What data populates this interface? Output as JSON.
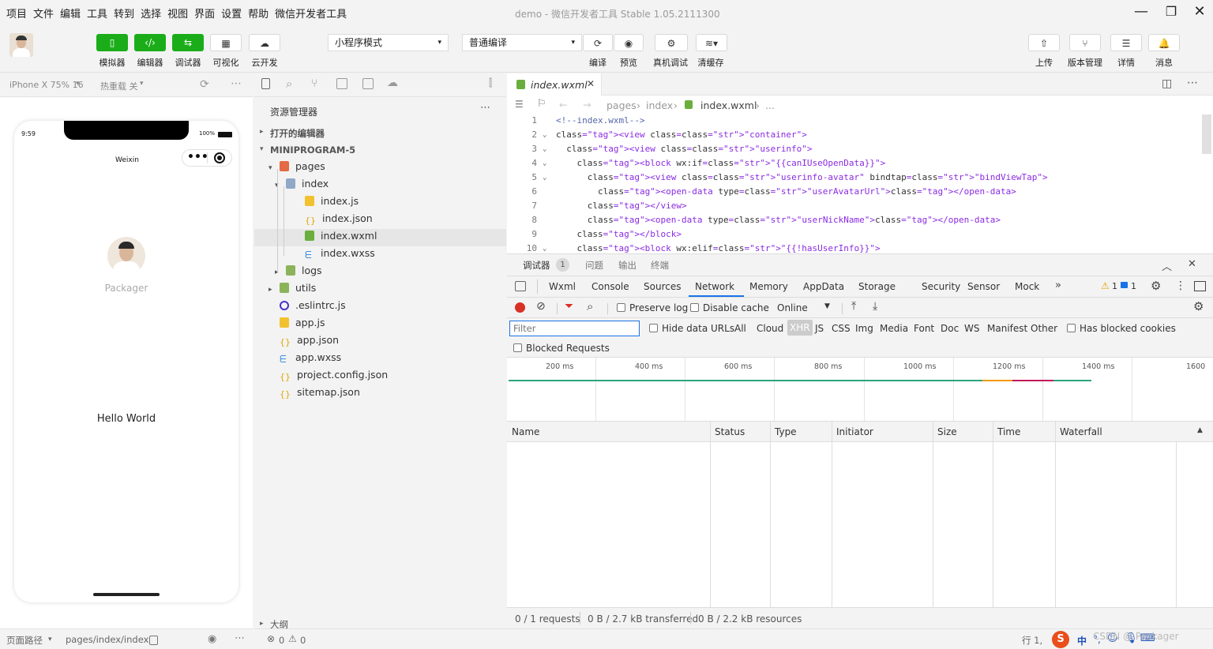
{
  "menu": [
    "项目",
    "文件",
    "编辑",
    "工具",
    "转到",
    "选择",
    "视图",
    "界面",
    "设置",
    "帮助",
    "微信开发者工具"
  ],
  "window_title": "demo - 微信开发者工具 Stable 1.05.2111300",
  "toolbar": {
    "left_buttons": [
      {
        "icon": "phone-icon",
        "label": "模拟器"
      },
      {
        "icon": "code-icon",
        "label": "编辑器"
      },
      {
        "icon": "debug-icon",
        "label": "调试器"
      },
      {
        "icon": "visual-icon",
        "label": "可视化"
      },
      {
        "icon": "cloud-icon",
        "label": "云开发"
      }
    ],
    "mode_select": "小程序模式",
    "compile_select": "普通编译",
    "mid_buttons": [
      {
        "icon": "refresh-icon",
        "label": "编译"
      },
      {
        "icon": "eye-icon",
        "label": "预览"
      },
      {
        "icon": "bug-icon",
        "label": "真机调试"
      },
      {
        "icon": "layers-icon",
        "label": "清缓存"
      }
    ],
    "right_buttons": [
      {
        "icon": "upload-icon",
        "label": "上传"
      },
      {
        "icon": "branch-icon",
        "label": "版本管理"
      },
      {
        "icon": "menu-icon",
        "label": "详情"
      },
      {
        "icon": "bell-icon",
        "label": "消息"
      }
    ]
  },
  "simulator": {
    "device": "iPhone X 75% 16",
    "hot_reload": "热重载 关",
    "time": "9:59",
    "battery": "100%",
    "nav_title": "Weixin",
    "nickname": "Packager",
    "hello": "Hello World"
  },
  "sim_status": {
    "path_label": "页面路径",
    "path": "pages/index/index"
  },
  "explorer": {
    "title": "资源管理器",
    "open_editors": "打开的编辑器",
    "project": "MINIPROGRAM-5",
    "items": [
      {
        "label": "pages",
        "depth": 1,
        "type": "folder-red",
        "arrow": "▾"
      },
      {
        "label": "index",
        "depth": 2,
        "type": "folder",
        "arrow": "▾"
      },
      {
        "label": "index.js",
        "depth": 3,
        "type": "js"
      },
      {
        "label": "index.json",
        "depth": 3,
        "type": "json"
      },
      {
        "label": "index.wxml",
        "depth": 3,
        "type": "wxml"
      },
      {
        "label": "index.wxss",
        "depth": 3,
        "type": "wxss"
      },
      {
        "label": "logs",
        "depth": 2,
        "type": "folder-green",
        "arrow": "▸"
      },
      {
        "label": "utils",
        "depth": 1,
        "type": "folder-green",
        "arrow": "▸"
      },
      {
        "label": ".eslintrc.js",
        "depth": 1,
        "type": "eslint"
      },
      {
        "label": "app.js",
        "depth": 1,
        "type": "js"
      },
      {
        "label": "app.json",
        "depth": 1,
        "type": "json"
      },
      {
        "label": "app.wxss",
        "depth": 1,
        "type": "wxss"
      },
      {
        "label": "project.config.json",
        "depth": 1,
        "type": "json"
      },
      {
        "label": "sitemap.json",
        "depth": 1,
        "type": "json"
      }
    ],
    "outline": "大纲",
    "errors": "0",
    "warnings": "0"
  },
  "editor": {
    "tab": "index.wxml",
    "breadcrumb": [
      "pages",
      "index",
      "index.wxml",
      "..."
    ],
    "lines": [
      {
        "n": "1",
        "t": "<!--index.wxml-->"
      },
      {
        "n": "2",
        "t": "<view class=\"container\">"
      },
      {
        "n": "3",
        "t": "  <view class=\"userinfo\">"
      },
      {
        "n": "4",
        "t": "    <block wx:if=\"{{canIUseOpenData}}\">"
      },
      {
        "n": "5",
        "t": "      <view class=\"userinfo-avatar\" bindtap=\"bindViewTap\">"
      },
      {
        "n": "6",
        "t": "        <open-data type=\"userAvatarUrl\"></open-data>"
      },
      {
        "n": "7",
        "t": "      </view>"
      },
      {
        "n": "8",
        "t": "      <open-data type=\"userNickName\"></open-data>"
      },
      {
        "n": "9",
        "t": "    </block>"
      },
      {
        "n": "10",
        "t": "    <block wx:elif=\"{{!hasUserInfo}}\">"
      }
    ]
  },
  "devtools": {
    "top_tabs": [
      "调试器",
      "1",
      "问题",
      "输出",
      "终端"
    ],
    "tabs": [
      "Wxml",
      "Console",
      "Sources",
      "Network",
      "Memory",
      "AppData",
      "Storage",
      "Security",
      "Sensor",
      "Mock"
    ],
    "active_tab": "Network",
    "warn_count": "1",
    "info_count": "1",
    "preserve_log": "Preserve log",
    "disable_cache": "Disable cache",
    "throttle": "Online",
    "filter_placeholder": "Filter",
    "hide_data_urls": "Hide data URLs",
    "types": [
      "All",
      "Cloud",
      "XHR",
      "JS",
      "CSS",
      "Img",
      "Media",
      "Font",
      "Doc",
      "WS",
      "Manifest",
      "Other"
    ],
    "active_type": "XHR",
    "blocked_cookies": "Has blocked cookies",
    "blocked_requests": "Blocked Requests",
    "ticks": [
      "200 ms",
      "400 ms",
      "600 ms",
      "800 ms",
      "1000 ms",
      "1200 ms",
      "1400 ms",
      "1600"
    ],
    "columns": [
      "Name",
      "Status",
      "Type",
      "Initiator",
      "Size",
      "Time",
      "Waterfall"
    ],
    "status": {
      "requests": "0 / 1 requests",
      "transferred": "0 B / 2.7 kB transferred",
      "resources": "0 B / 2.2 kB resources"
    }
  },
  "footer": {
    "pos": "行 1,",
    "csdn": "CSDN @ Packager"
  },
  "colors": {
    "green": "#1aad19",
    "accent": "#1a73e8"
  }
}
